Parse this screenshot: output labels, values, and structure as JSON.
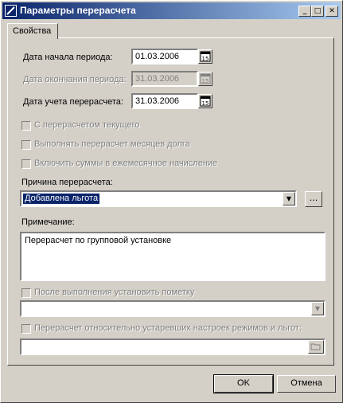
{
  "window": {
    "title": "Параметры перерасчета",
    "icon": "app-icon",
    "controls": [
      "minimize-icon",
      "maximize-icon",
      "close-icon"
    ]
  },
  "tabs": [
    "Свойства"
  ],
  "form": {
    "period_start": {
      "label": "Дата начала периода:",
      "value": "01.03.2006",
      "enabled": true
    },
    "period_end": {
      "label": "Дата окончания периода:",
      "value": "31.03.2006",
      "enabled": false
    },
    "recalc_date": {
      "label": "Дата учета перерасчета:",
      "value": "31.03.2006",
      "enabled": true
    },
    "calendar_icon_text": "15",
    "checkboxes": [
      {
        "label": "С перерасчетом текущего",
        "checked": false,
        "enabled": false
      },
      {
        "label": "Выполнять перерасчет месяцев долга",
        "checked": false,
        "enabled": false
      },
      {
        "label": "Включить суммы в ежемесячное начисление",
        "checked": false,
        "enabled": false
      }
    ],
    "reason": {
      "label": "Причина перерасчета:",
      "value": "Добавлена льгота",
      "ellipsis": "..."
    },
    "note": {
      "label": "Примечание:",
      "value": "Перерасчет по групповой установке"
    },
    "after_mark": {
      "label": "После выполнения установить пометку",
      "checked": false,
      "enabled": false,
      "value": ""
    },
    "outdated": {
      "label": "Перерасчет относительно устаревших настроек режимов и льгот:",
      "checked": false,
      "enabled": false,
      "value": ""
    }
  },
  "buttons": {
    "ok": "OK",
    "cancel": "Отмена"
  }
}
